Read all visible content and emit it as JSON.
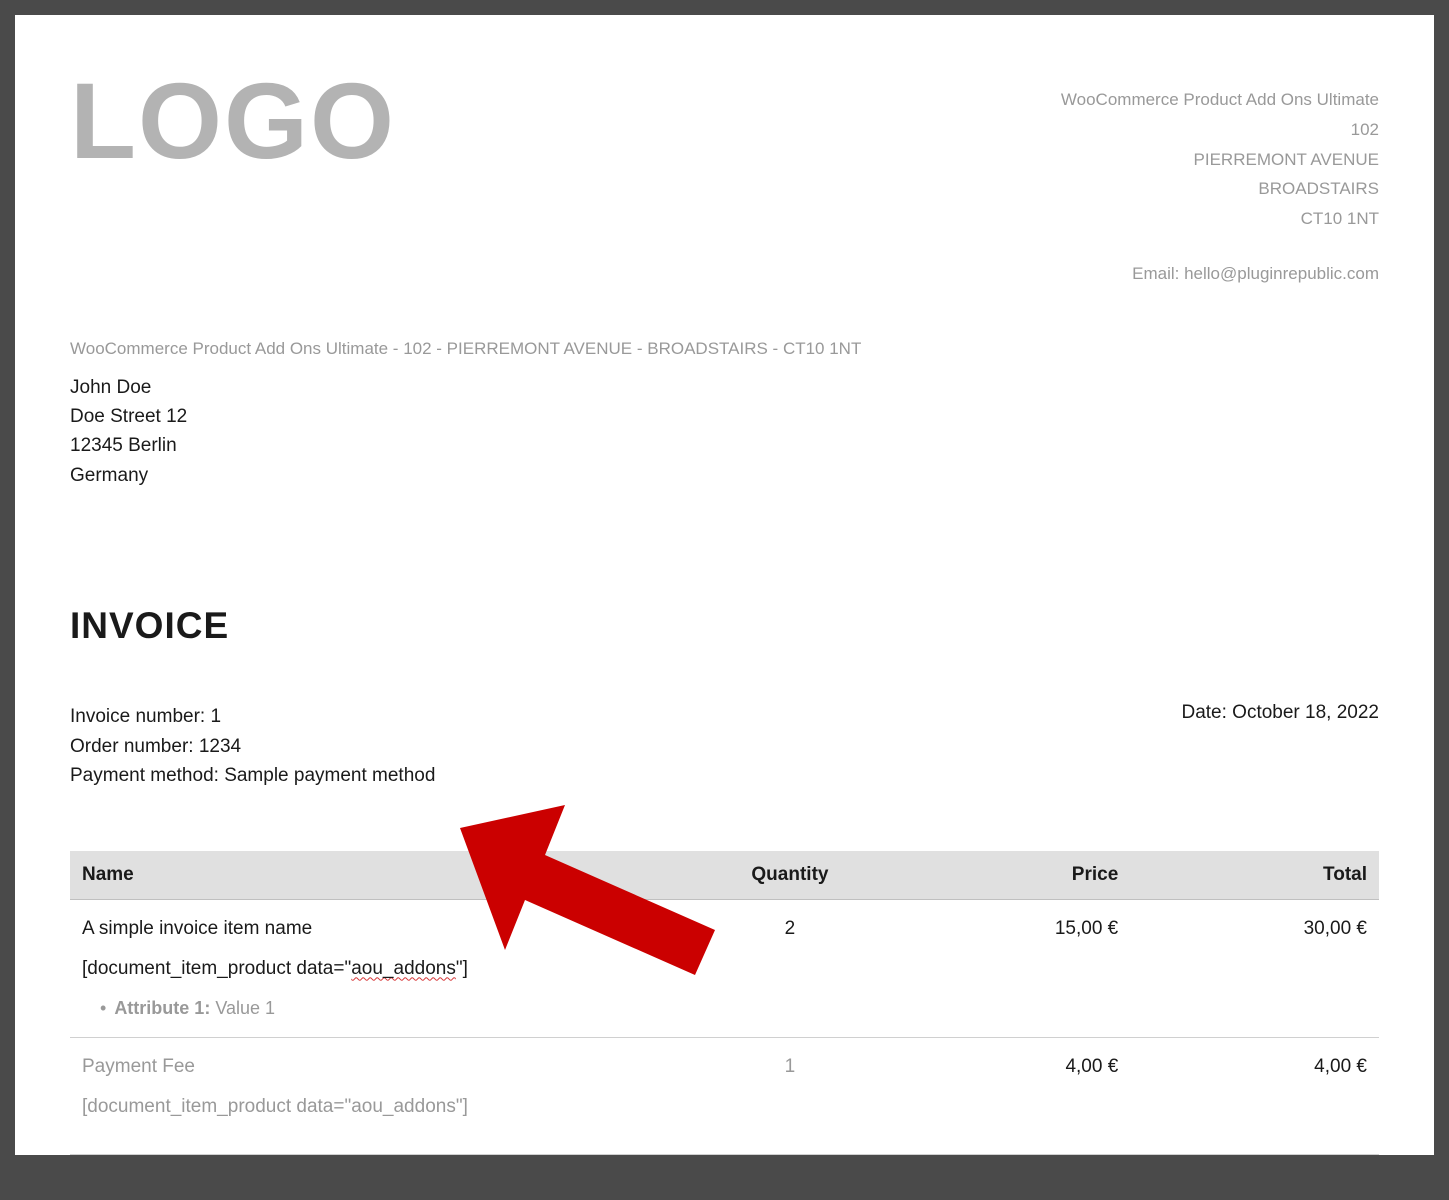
{
  "logo_text": "LOGO",
  "company": {
    "name": "WooCommerce Product Add Ons Ultimate",
    "addr1": "102",
    "addr2": "PIERREMONT AVENUE",
    "city": "BROADSTAIRS",
    "postcode": "CT10 1NT",
    "email_label": "Email: hello@pluginrepublic.com"
  },
  "sender_address_line": "WooCommerce Product Add Ons Ultimate - 102 - PIERREMONT AVENUE - BROADSTAIRS - CT10 1NT",
  "customer": {
    "name": "John Doe",
    "street": "Doe Street 12",
    "city": "12345 Berlin",
    "country": "Germany"
  },
  "invoice_title": "INVOICE",
  "meta": {
    "invoice_number": "Invoice number: 1",
    "order_number": "Order number: 1234",
    "payment_method": "Payment method: Sample payment method",
    "date": "Date: October 18, 2022"
  },
  "table": {
    "headers": {
      "name": "Name",
      "quantity": "Quantity",
      "price": "Price",
      "total": "Total"
    },
    "rows": [
      {
        "name": "A simple invoice item name",
        "shortcode_prefix": "[document_item_product data=\"",
        "shortcode_squiggle": "aou_addons",
        "shortcode_suffix": "\"]",
        "attribute_label": "Attribute 1:",
        "attribute_value": " Value 1",
        "quantity": "2",
        "price": "15,00 €",
        "total": "30,00 €"
      },
      {
        "name": "Payment Fee",
        "shortcode_full": "[document_item_product data=\"aou_addons\"]",
        "quantity": "1",
        "price": "4,00 €",
        "total": "4,00 €"
      }
    ]
  },
  "annotation": {
    "arrow_color": "#cb0000"
  }
}
